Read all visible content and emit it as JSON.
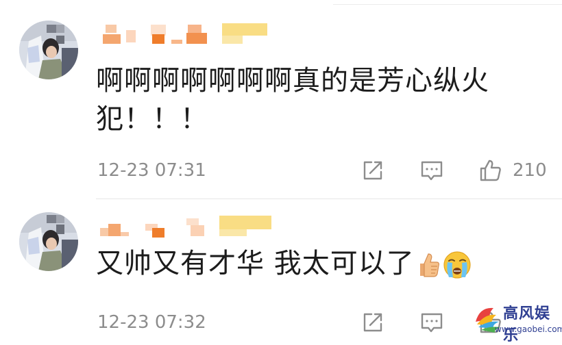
{
  "comments": [
    {
      "username": "",
      "text_line1": "啊啊啊啊啊啊啊真的是芳心纵火",
      "text_line2": "犯！！！",
      "timestamp": "12-23 07:31",
      "like_count": "210",
      "icons": [
        "share-icon",
        "comment-icon",
        "thumbs-up-icon"
      ]
    },
    {
      "username": "",
      "text": "又帅又有才华 我太可以了",
      "emojis": [
        "thumbs-up-emoji",
        "crying-face-emoji"
      ],
      "timestamp": "12-23 07:32",
      "icons": [
        "share-icon",
        "comment-icon",
        "thumbs-up-icon"
      ]
    }
  ],
  "watermark": {
    "title": "高风娱乐",
    "url": "www.gaobei.com"
  },
  "colors": {
    "text": "#1c1c1c",
    "meta": "#8c8c8c",
    "icon": "#8c8c8c",
    "watermark": "#2f3f92",
    "username_blur_orange": "#f39a4f",
    "username_blur_yellow": "#f7d46a"
  }
}
